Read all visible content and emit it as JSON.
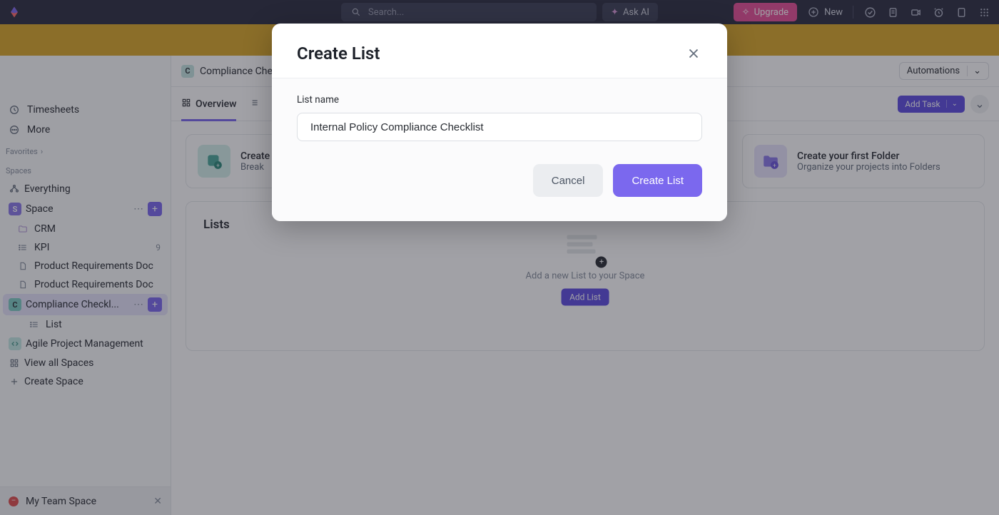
{
  "topbar": {
    "search_placeholder": "Search...",
    "ask_ai": "Ask AI",
    "upgrade": "Upgrade",
    "new": "New"
  },
  "sidebar": {
    "timesheets": "Timesheets",
    "more": "More",
    "favorites": "Favorites",
    "spaces": "Spaces",
    "everything": "Everything",
    "space": {
      "label": "Space",
      "badge": "S"
    },
    "items": {
      "crm": "CRM",
      "kpi": {
        "label": "KPI",
        "count": "9"
      },
      "prd1": "Product Requirements Doc",
      "prd2": "Product Requirements Doc",
      "compliance": {
        "label": "Compliance Checkl...",
        "badge": "C"
      },
      "list": "List"
    },
    "agile": "Agile Project Management",
    "view_all": "View all Spaces",
    "create_space": "Create Space",
    "my_team_space": "My Team Space"
  },
  "breadcrumb": {
    "badge": "C",
    "title": "Compliance Che",
    "automations": "Automations"
  },
  "tabs": {
    "overview": "Overview"
  },
  "actions": {
    "add_task": "Add Task"
  },
  "cards": {
    "left_title": "Create",
    "left_sub": "Break",
    "right_title": "Create your first Folder",
    "right_sub": "Organize your projects into Folders"
  },
  "lists": {
    "title": "Lists",
    "empty_text": "Add a new List to your Space",
    "add_list": "Add List"
  },
  "modal": {
    "title": "Create List",
    "field_label": "List name",
    "input_value": "Internal Policy Compliance Checklist",
    "cancel": "Cancel",
    "create": "Create List"
  }
}
